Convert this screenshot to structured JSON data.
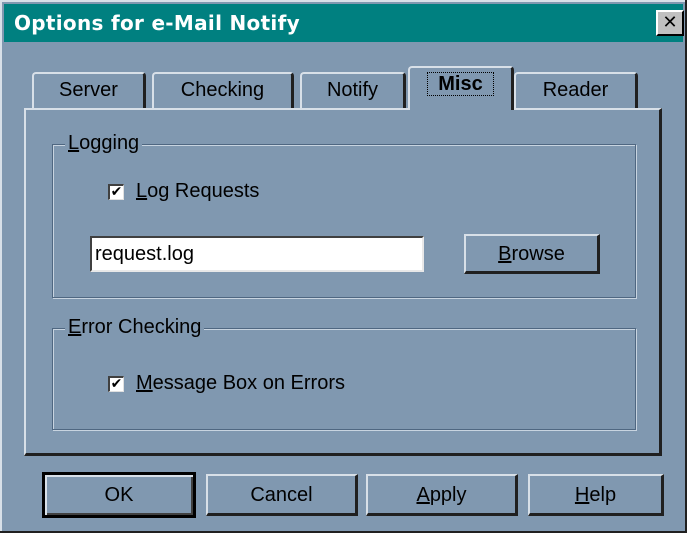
{
  "window": {
    "title": "Options for e-Mail Notify",
    "close_glyph": "✕"
  },
  "tabs": [
    {
      "label": "Server",
      "active": false
    },
    {
      "label": "Checking",
      "active": false
    },
    {
      "label": "Notify",
      "active": false
    },
    {
      "label": "Misc",
      "active": true
    },
    {
      "label": "Reader",
      "active": false
    }
  ],
  "logging": {
    "group_label_mnemonic": "L",
    "group_label_rest": "ogging",
    "log_requests": {
      "checked": true,
      "check_glyph": "✔",
      "label_mnemonic": "L",
      "label_rest": "og Requests"
    },
    "filename_value": "request.log",
    "browse_mnemonic": "B",
    "browse_rest": "rowse"
  },
  "error_checking": {
    "group_label_mnemonic": "E",
    "group_label_rest": "rror Checking",
    "message_box": {
      "checked": true,
      "check_glyph": "✔",
      "label_mnemonic": "M",
      "label_rest": "essage Box on Errors"
    }
  },
  "buttons": {
    "ok_label": "OK",
    "cancel_label": "Cancel",
    "apply_mnemonic": "A",
    "apply_rest": "pply",
    "help_mnemonic": "H",
    "help_rest": "elp"
  }
}
